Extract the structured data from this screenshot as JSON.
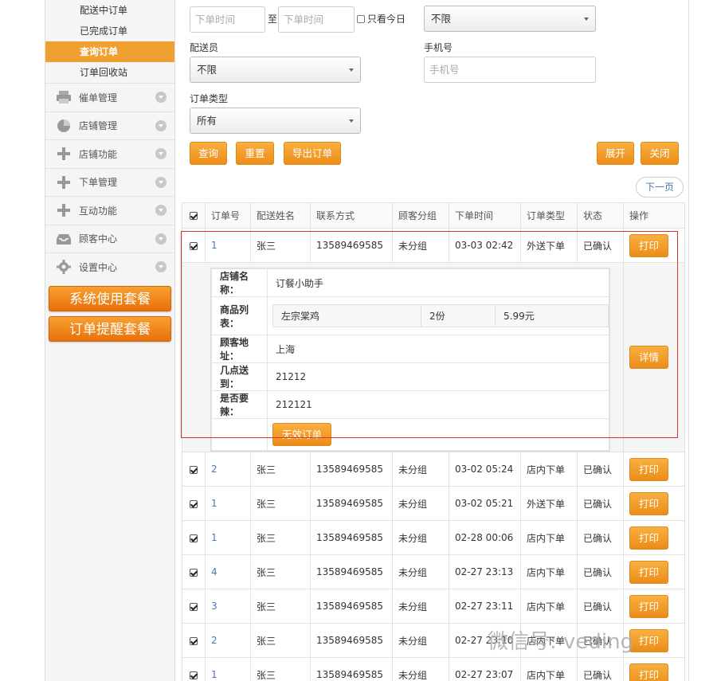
{
  "sidebar": {
    "sub_items": [
      "配送中订单",
      "已完成订单",
      "查询订单",
      "订单回收站"
    ],
    "active_index": 2,
    "nav_items": [
      {
        "label": "催单管理",
        "icon": "printer-icon"
      },
      {
        "label": "店铺管理",
        "icon": "pie-chart-icon"
      },
      {
        "label": "店铺功能",
        "icon": "plus-icon"
      },
      {
        "label": "下单管理",
        "icon": "plus-icon"
      },
      {
        "label": "互动功能",
        "icon": "plus-icon"
      },
      {
        "label": "顾客中心",
        "icon": "inbox-icon"
      },
      {
        "label": "设置中心",
        "icon": "gear-icon"
      }
    ],
    "packages": [
      "系统使用套餐",
      "订单提醒套餐"
    ]
  },
  "filters": {
    "start_time_placeholder": "下单时间",
    "to_label": "至",
    "end_time_placeholder": "下单时间",
    "today_only_label": "只看今日",
    "top_select_value": "不限",
    "courier_label": "配送员",
    "courier_value": "不限",
    "phone_label": "手机号",
    "phone_placeholder": "手机号",
    "order_type_label": "订单类型",
    "order_type_value": "所有"
  },
  "actions": {
    "query": "查询",
    "reset": "重置",
    "export": "导出订单",
    "expand": "展开",
    "close": "关闭",
    "next_page": "下一页"
  },
  "table": {
    "headers": [
      "订单号",
      "配送姓名",
      "联系方式",
      "顾客分组",
      "下单时间",
      "订单类型",
      "状态",
      "操作"
    ],
    "print_label": "打印",
    "detail_label": "详情",
    "first_row": {
      "id": "1",
      "name": "张三",
      "phone": "13589469585",
      "group": "未分组",
      "time": "03-03 02:42",
      "type": "外送下单",
      "status": "已确认"
    },
    "detail": {
      "shop_key": "店铺名称：",
      "shop_val": "订餐小助手",
      "goods_key": "商品列表：",
      "goods": {
        "name": "左宗棠鸡",
        "qty": "2份",
        "price": "5.99元"
      },
      "address_key": "顾客地址：",
      "address_val": "上海",
      "arrive_key": "几点送到：",
      "arrive_val": "21212",
      "spicy_key": "是否要辣：",
      "spicy_val": "212121",
      "invalid_btn": "无效订单"
    },
    "rows": [
      {
        "id": "2",
        "name": "张三",
        "phone": "13589469585",
        "group": "未分组",
        "time": "03-02 05:24",
        "type": "店内下单",
        "status": "已确认"
      },
      {
        "id": "1",
        "name": "张三",
        "phone": "13589469585",
        "group": "未分组",
        "time": "03-02 05:21",
        "type": "外送下单",
        "status": "已确认"
      },
      {
        "id": "1",
        "name": "张三",
        "phone": "13589469585",
        "group": "未分组",
        "time": "02-28 00:06",
        "type": "店内下单",
        "status": "已确认"
      },
      {
        "id": "4",
        "name": "张三",
        "phone": "13589469585",
        "group": "未分组",
        "time": "02-27 23:13",
        "type": "店内下单",
        "status": "已确认"
      },
      {
        "id": "3",
        "name": "张三",
        "phone": "13589469585",
        "group": "未分组",
        "time": "02-27 23:11",
        "type": "店内下单",
        "status": "已确认"
      },
      {
        "id": "2",
        "name": "张三",
        "phone": "13589469585",
        "group": "未分组",
        "time": "02-27 23:10",
        "type": "店内下单",
        "status": "已确认"
      },
      {
        "id": "1",
        "name": "张三",
        "phone": "13589469585",
        "group": "未分组",
        "time": "02-27 23:07",
        "type": "店内下单",
        "status": "已确认"
      }
    ]
  },
  "watermark": "微信号: veding"
}
